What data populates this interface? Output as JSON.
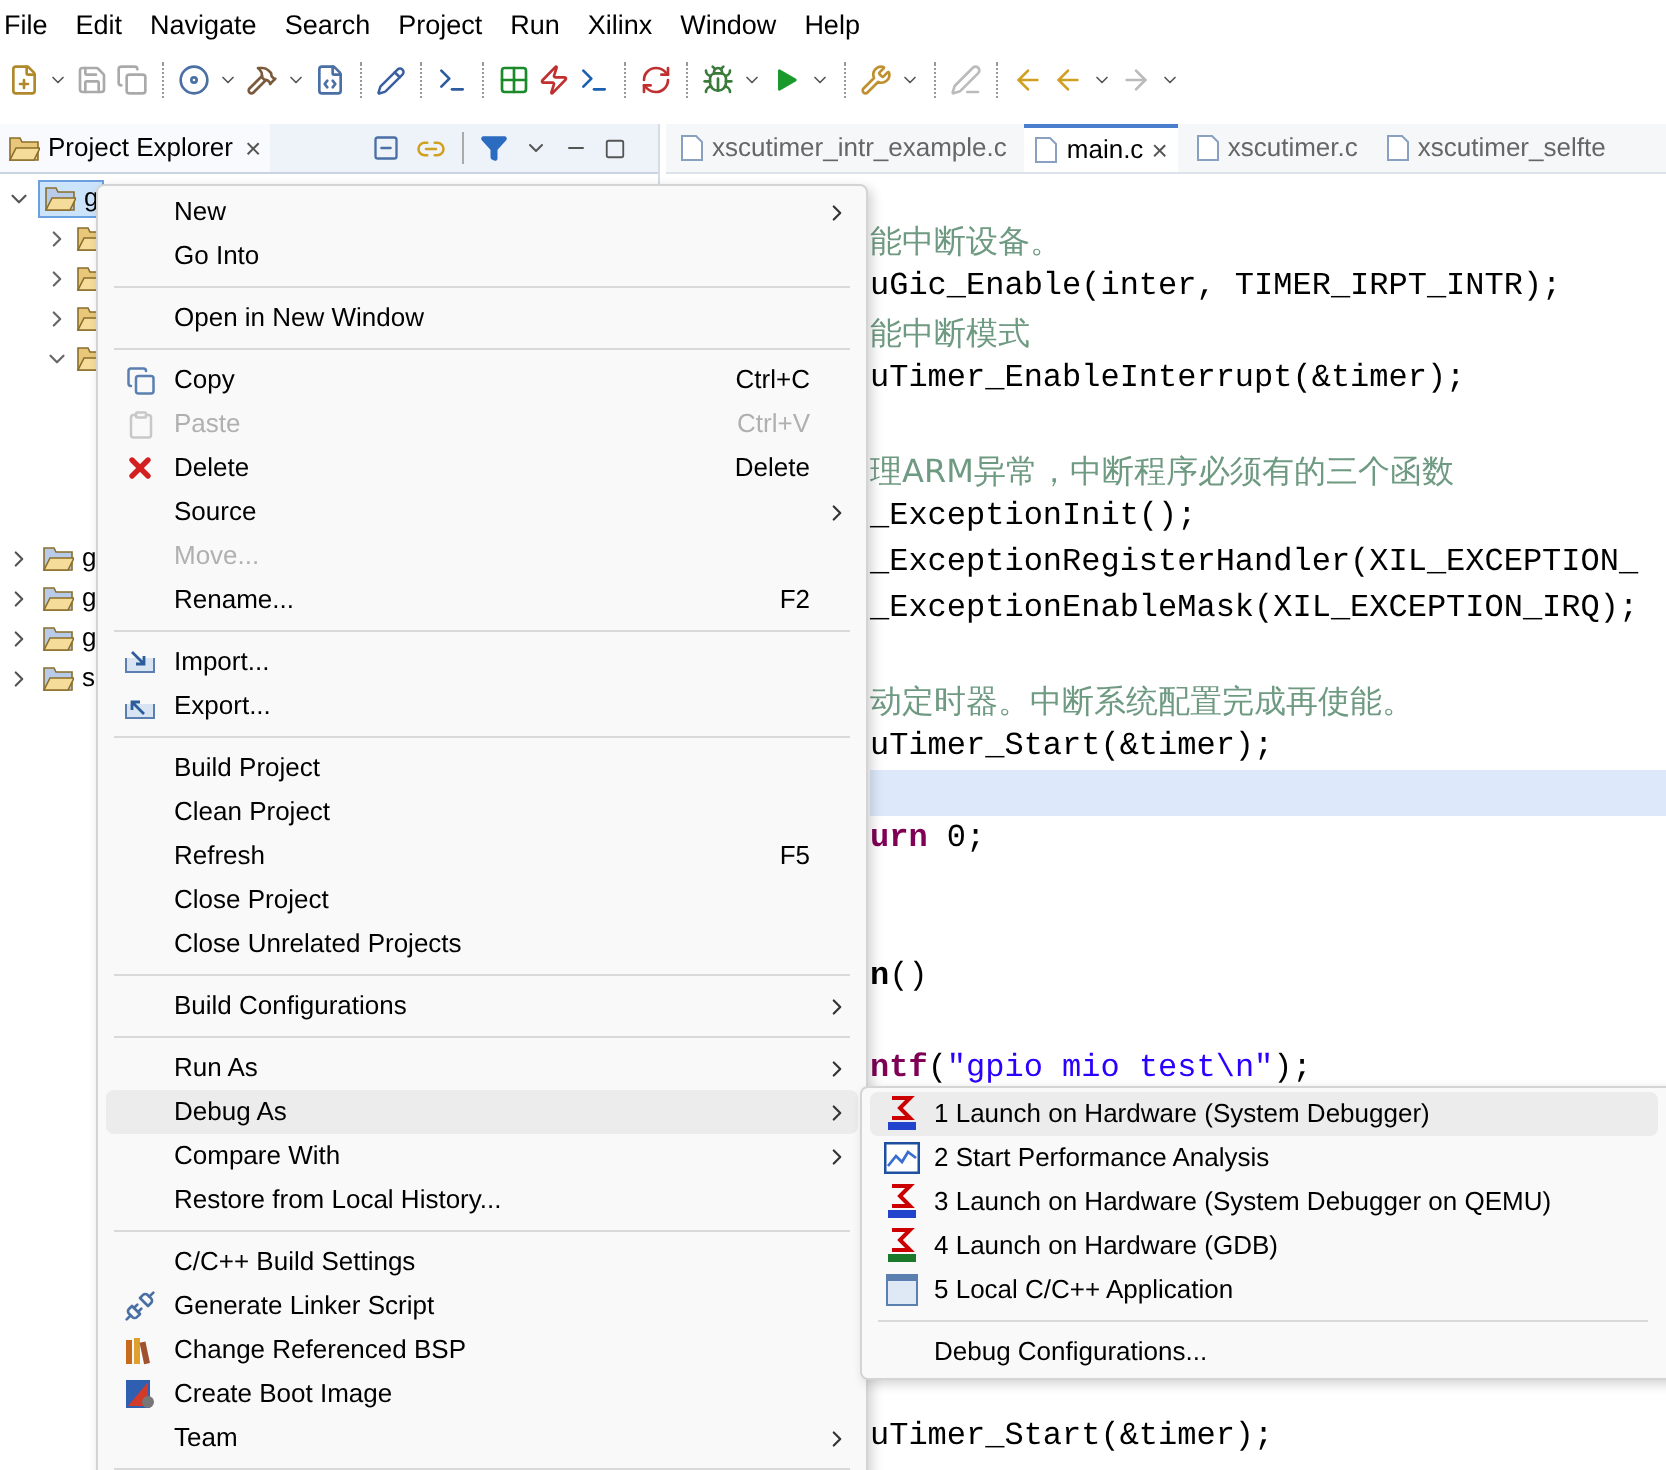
{
  "menu_bar": [
    "File",
    "Edit",
    "Navigate",
    "Search",
    "Project",
    "Run",
    "Xilinx",
    "Window",
    "Help"
  ],
  "explorer": {
    "title": "Project Explorer",
    "close": "×",
    "tree": [
      {
        "label": "g",
        "selected": true,
        "expanded": true,
        "children": [
          {
            "expanded": false
          },
          {
            "expanded": false
          },
          {
            "expanded": false
          },
          {
            "expanded": true
          }
        ]
      },
      {
        "label": "g",
        "selected": false,
        "expanded": false
      },
      {
        "label": "g",
        "selected": false,
        "expanded": false
      },
      {
        "label": "g",
        "selected": false,
        "expanded": false
      },
      {
        "label": "s",
        "selected": false,
        "expanded": false
      }
    ]
  },
  "editor_tabs": [
    {
      "label": "xscutimer_intr_example.c",
      "selected": false
    },
    {
      "label": "main.c",
      "selected": true,
      "close": "×"
    },
    {
      "label": "xscutimer.c",
      "selected": false
    },
    {
      "label": "xscutimer_selfte",
      "selected": false
    }
  ],
  "code_lines": [
    {
      "current": false,
      "tokens": [
        {
          "kind": "comment",
          "text": "能中断设备。"
        }
      ]
    },
    {
      "current": false,
      "tokens": [
        {
          "kind": "plain",
          "text": "uGic_Enable(inter, TIMER_IRPT_INTR);"
        }
      ]
    },
    {
      "current": false,
      "tokens": [
        {
          "kind": "comment",
          "text": "能中断模式"
        }
      ]
    },
    {
      "current": false,
      "tokens": [
        {
          "kind": "plain",
          "text": "uTimer_EnableInterrupt(&timer);"
        }
      ]
    },
    {
      "current": false
    },
    {
      "current": false,
      "tokens": [
        {
          "kind": "comment",
          "text": "理ARM异常，中断程序必须有的三个函数"
        }
      ]
    },
    {
      "current": false,
      "tokens": [
        {
          "kind": "plain",
          "text": "_ExceptionInit();"
        }
      ]
    },
    {
      "current": false,
      "tokens": [
        {
          "kind": "plain",
          "text": "_ExceptionRegisterHandler(XIL_EXCEPTION_"
        }
      ]
    },
    {
      "current": false,
      "tokens": [
        {
          "kind": "plain",
          "text": "_ExceptionEnableMask(XIL_EXCEPTION_IRQ);"
        }
      ]
    },
    {
      "current": false
    },
    {
      "current": false,
      "tokens": [
        {
          "kind": "comment",
          "text": "动定时器。中断系统配置完成再使能。"
        }
      ]
    },
    {
      "current": false,
      "tokens": [
        {
          "kind": "plain",
          "text": "uTimer_Start(&timer);"
        }
      ]
    },
    {
      "current": true
    },
    {
      "current": false,
      "tokens": [
        {
          "kind": "keyword",
          "text": "urn"
        },
        {
          "kind": "plain",
          "text": " 0;"
        }
      ]
    },
    {
      "current": false
    },
    {
      "current": false
    },
    {
      "current": false,
      "tokens": [
        {
          "kind": "bold",
          "text": "n"
        },
        {
          "kind": "plain",
          "text": "()"
        }
      ]
    },
    {
      "current": false
    },
    {
      "current": false,
      "tokens": [
        {
          "kind": "keyword",
          "text": "ntf"
        },
        {
          "kind": "plain",
          "text": "("
        },
        {
          "kind": "string",
          "text": "\"gpio mio test\\n\""
        },
        {
          "kind": "plain",
          "text": ");"
        }
      ]
    },
    {
      "current": false,
      "tokens": [
        {
          "kind": "plain",
          "text": "uTimer_Start(&timer);"
        }
      ]
    }
  ],
  "context_menu": [
    {
      "kind": "submenu",
      "label": "New",
      "selected": false,
      "disabled": false
    },
    {
      "kind": "item",
      "label": "Go Into",
      "selected": false,
      "disabled": false
    },
    {
      "kind": "separator"
    },
    {
      "kind": "item",
      "label": "Open in New Window",
      "selected": false,
      "disabled": false
    },
    {
      "kind": "separator"
    },
    {
      "kind": "item",
      "label": "Copy",
      "shortcut": "Ctrl+C",
      "selected": false,
      "disabled": false
    },
    {
      "kind": "item",
      "label": "Paste",
      "shortcut": "Ctrl+V",
      "selected": false,
      "disabled": true
    },
    {
      "kind": "item",
      "label": "Delete",
      "shortcut": "Delete",
      "selected": false,
      "disabled": false
    },
    {
      "kind": "submenu",
      "label": "Source",
      "selected": false,
      "disabled": false
    },
    {
      "kind": "item",
      "label": "Move...",
      "selected": false,
      "disabled": true
    },
    {
      "kind": "item",
      "label": "Rename...",
      "shortcut": "F2",
      "selected": false,
      "disabled": false
    },
    {
      "kind": "separator"
    },
    {
      "kind": "item",
      "label": "Import...",
      "selected": false,
      "disabled": false
    },
    {
      "kind": "item",
      "label": "Export...",
      "selected": false,
      "disabled": false
    },
    {
      "kind": "separator"
    },
    {
      "kind": "item",
      "label": "Build Project",
      "selected": false,
      "disabled": false
    },
    {
      "kind": "item",
      "label": "Clean Project",
      "selected": false,
      "disabled": false
    },
    {
      "kind": "item",
      "label": "Refresh",
      "shortcut": "F5",
      "selected": false,
      "disabled": false
    },
    {
      "kind": "item",
      "label": "Close Project",
      "selected": false,
      "disabled": false
    },
    {
      "kind": "item",
      "label": "Close Unrelated Projects",
      "selected": false,
      "disabled": false
    },
    {
      "kind": "separator"
    },
    {
      "kind": "submenu",
      "label": "Build Configurations",
      "selected": false,
      "disabled": false
    },
    {
      "kind": "separator"
    },
    {
      "kind": "submenu",
      "label": "Run As",
      "selected": false,
      "disabled": false
    },
    {
      "kind": "submenu",
      "label": "Debug As",
      "selected": true,
      "disabled": false
    },
    {
      "kind": "submenu",
      "label": "Compare With",
      "selected": false,
      "disabled": false
    },
    {
      "kind": "item",
      "label": "Restore from Local History...",
      "selected": false,
      "disabled": false
    },
    {
      "kind": "separator"
    },
    {
      "kind": "item",
      "label": "C/C++ Build Settings",
      "selected": false,
      "disabled": false
    },
    {
      "kind": "item",
      "label": "Generate Linker Script",
      "selected": false,
      "disabled": false
    },
    {
      "kind": "item",
      "label": "Change Referenced BSP",
      "selected": false,
      "disabled": false
    },
    {
      "kind": "item",
      "label": "Create Boot Image",
      "selected": false,
      "disabled": false
    },
    {
      "kind": "submenu",
      "label": "Team",
      "selected": false,
      "disabled": false
    },
    {
      "kind": "separator"
    }
  ],
  "debug_submenu": [
    {
      "kind": "item",
      "label": "1 Launch on Hardware (System Debugger)",
      "selected": true
    },
    {
      "kind": "item",
      "label": "2 Start Performance Analysis",
      "selected": false
    },
    {
      "kind": "item",
      "label": "3 Launch on Hardware (System Debugger on QEMU)",
      "selected": false
    },
    {
      "kind": "item",
      "label": "4 Launch on Hardware (GDB)",
      "selected": false
    },
    {
      "kind": "item",
      "label": "5 Local C/C++ Application",
      "selected": false
    },
    {
      "kind": "separator"
    },
    {
      "kind": "item",
      "label": "Debug Configurations...",
      "selected": false
    }
  ]
}
